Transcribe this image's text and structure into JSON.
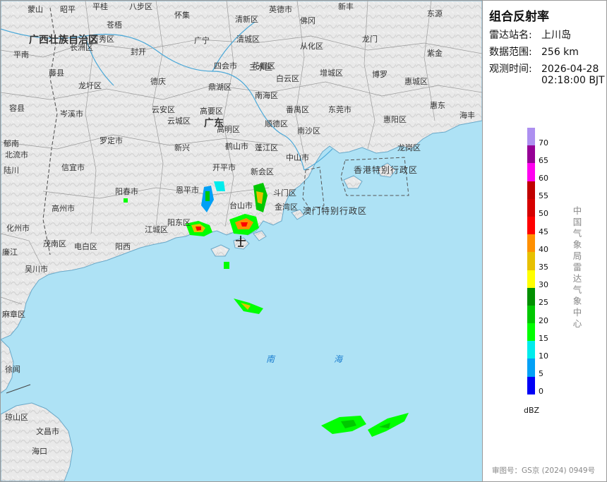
{
  "panel": {
    "title": "组合反射率",
    "station_label": "雷达站名:",
    "station_value": "上川岛",
    "range_label": "数据范围:",
    "range_value": "256 km",
    "time_label": "观测时间:",
    "time_date": "2026-04-28",
    "time_clock": "02:18:00 BJT",
    "agency": "中国气象局雷达气象中心",
    "approval": "审图号：GS京 (2024) 0949号",
    "unit": "dBZ"
  },
  "legend": {
    "colors": [
      "#0000f6",
      "#01a0f6",
      "#00ecec",
      "#01ff00",
      "#00c800",
      "#019000",
      "#ffff00",
      "#e7c000",
      "#ff9000",
      "#ff0000",
      "#d60000",
      "#c00000",
      "#ff00f0",
      "#960096",
      "#ad90f0"
    ],
    "ticks": [
      "0",
      "5",
      "10",
      "15",
      "20",
      "25",
      "30",
      "35",
      "40",
      "45",
      "50",
      "55",
      "60",
      "65",
      "70"
    ]
  },
  "map": {
    "regions": [
      "广西壮族自治区",
      "广东"
    ],
    "seas": [
      "南",
      "海"
    ],
    "sars": [
      "香港特别行政区",
      "澳门特别行政区"
    ],
    "places": [
      "蒙山",
      "昭平",
      "平桂",
      "八步区",
      "怀集",
      "英德市",
      "新丰",
      "东源",
      "苍梧",
      "万秀区",
      "清新区",
      "佛冈",
      "长洲区",
      "封开",
      "广宁",
      "清城区",
      "从化区",
      "龙门",
      "紫金",
      "平南",
      "藤县",
      "四会市",
      "花都区",
      "增城区",
      "龙圩区",
      "德庆",
      "鼎湖区",
      "三水区",
      "白云区",
      "南海区",
      "博罗",
      "惠城区",
      "容县",
      "郁南",
      "高要区",
      "番禺区",
      "东莞市",
      "惠阳区",
      "惠东",
      "岑溪市",
      "云安区",
      "云城区",
      "高明区",
      "顺德区",
      "南沙区",
      "海丰",
      "罗定市",
      "北流市",
      "新兴",
      "鹤山市",
      "蓬江区",
      "中山市",
      "龙岗区",
      "信宜市",
      "开平市",
      "新会区",
      "陆川",
      "阳春市",
      "恩平市",
      "斗门区",
      "高州市",
      "台山市",
      "金湾区",
      "化州市",
      "阳东区",
      "江城区",
      "茂南区",
      "电白区",
      "阳西",
      "廉江",
      "吴川市",
      "麻章区",
      "徐闻",
      "文昌市",
      "琼山区",
      "海口"
    ]
  },
  "chart_data": {
    "type": "radar_map",
    "title": "组合反射率",
    "station": "上川岛",
    "range": "256 km",
    "time": "2026-04-28 02:18:00 BJT",
    "scale_unit": "dBZ",
    "scale_values": [
      0,
      5,
      10,
      15,
      20,
      25,
      30,
      35,
      40,
      45,
      50,
      55,
      60,
      65,
      70
    ]
  }
}
